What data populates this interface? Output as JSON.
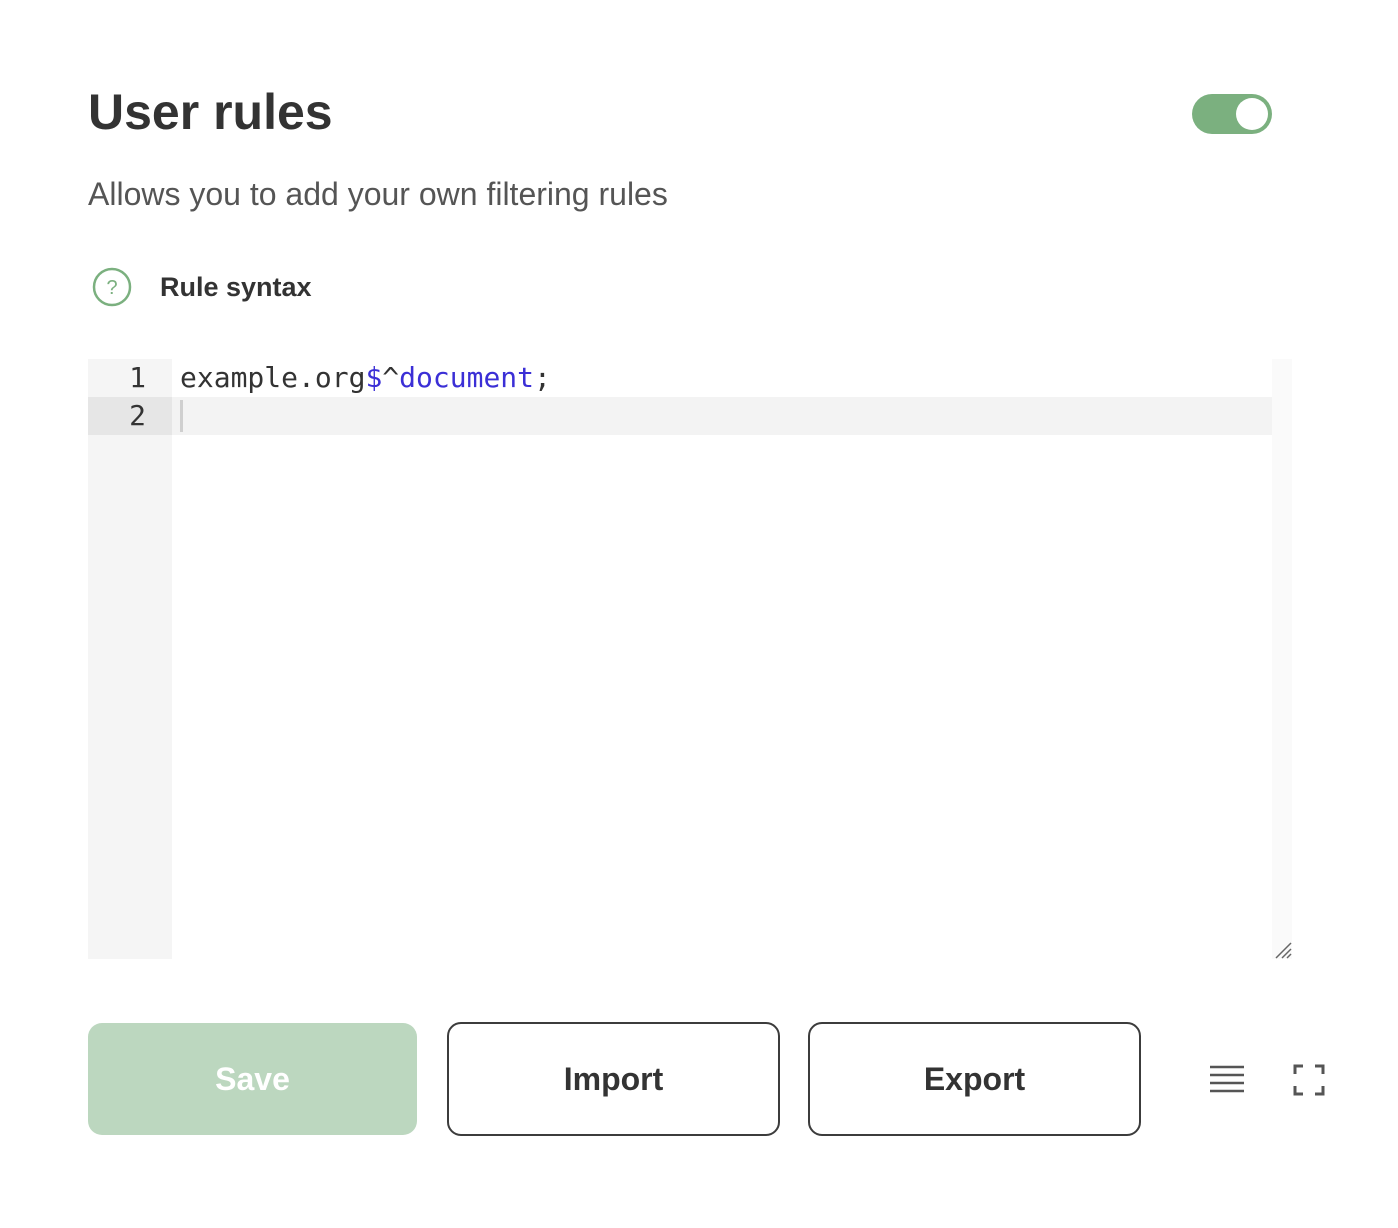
{
  "header": {
    "title": "User rules",
    "toggle_state": "on",
    "subtitle": "Allows you to add your own filtering rules"
  },
  "syntax": {
    "icon": "question-circle-icon",
    "label": "Rule syntax"
  },
  "editor": {
    "lines": [
      {
        "number": "1",
        "parts": [
          {
            "text": "example.org",
            "kind": "plain"
          },
          {
            "text": "$",
            "kind": "option"
          },
          {
            "text": "^",
            "kind": "plain"
          },
          {
            "text": "document",
            "kind": "option"
          },
          {
            "text": ";",
            "kind": "plain"
          }
        ]
      },
      {
        "number": "2",
        "parts": []
      }
    ],
    "active_line": 2
  },
  "actions": {
    "save_label": "Save",
    "import_label": "Import",
    "export_label": "Export",
    "wrap_icon": "line-wrap-icon",
    "fullscreen_icon": "fullscreen-icon"
  },
  "colors": {
    "accent": "#7bb07f",
    "save_disabled": "#bcd7bf",
    "option_token": "#3b2fd6"
  }
}
